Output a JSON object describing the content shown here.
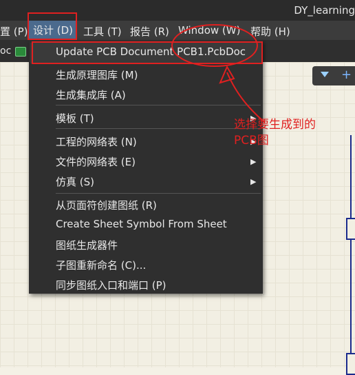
{
  "window": {
    "title": "DY_learning"
  },
  "menubar": {
    "items": [
      {
        "label": "置 (P)"
      },
      {
        "label": "设计 (D)"
      },
      {
        "label": "工具 (T)"
      },
      {
        "label": "报告 (R)"
      },
      {
        "label": "Window (W)"
      },
      {
        "label": "帮助 (H)"
      }
    ]
  },
  "toolbar": {
    "doc_tab": "oc"
  },
  "design_menu": {
    "items": [
      {
        "label": "Update PCB Document PCB1.PcbDoc"
      },
      {
        "label": "生成原理图库 (M)"
      },
      {
        "label": "生成集成库 (A)"
      },
      {
        "label": "模板 (T)"
      },
      {
        "label": "工程的网络表 (N)"
      },
      {
        "label": "文件的网络表 (E)"
      },
      {
        "label": "仿真 (S)"
      },
      {
        "label": "从页面符创建图纸 (R)"
      },
      {
        "label": "Create Sheet Symbol From Sheet"
      },
      {
        "label": "图纸生成器件"
      },
      {
        "label": "子图重新命名 (C)..."
      },
      {
        "label": "同步图纸入口和端口 (P)"
      }
    ]
  },
  "annotation": {
    "line1": "选择要生成到的",
    "line2": "PCB图",
    "color": "#e02020"
  },
  "colors": {
    "menu_active": "#4b6a8d",
    "menu_bg": "#2f2f2f",
    "accent_red": "#e02020"
  }
}
